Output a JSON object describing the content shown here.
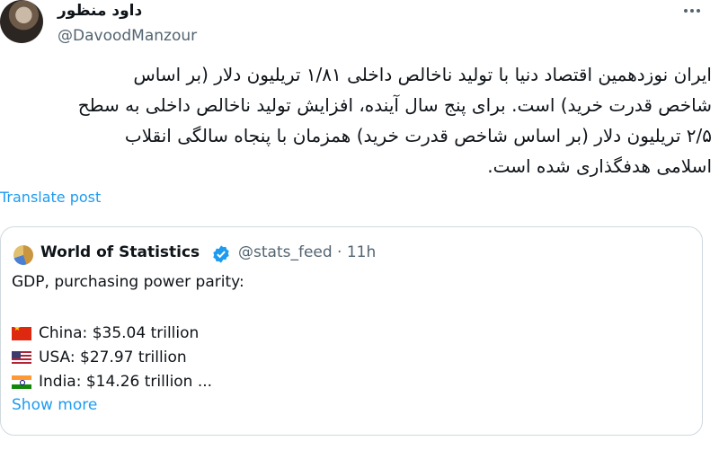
{
  "tweet": {
    "author_name": "داود منظور",
    "author_handle": "@DavoodManzour",
    "text_lines": [
      "ایران نوزدهمین اقتصاد دنیا با تولید ناخالص داخلی ۱/۸۱ تریلیون دلار (بر اساس",
      "شاخص قدرت خرید) است. برای پنج سال آینده، افزایش تولید ناخالص داخلی به سطح",
      "۲/۵ تریلیون دلار (بر اساس شاخص قدرت خرید) همزمان با پنجاه سالگی انقلاب",
      "اسلامی هدفگذاری شده است."
    ],
    "translate_label": "Translate post",
    "more_icon": "more-horizontal-icon"
  },
  "quote": {
    "author_name": "World of Statistics",
    "author_handle": "@stats_feed · 11h",
    "verified_icon": "verified-badge-icon",
    "verified_color": "#1d9bf0",
    "headline": "GDP, purchasing power parity:",
    "items": [
      {
        "flag": "china-flag-icon",
        "text": "China: $35.04 trillion"
      },
      {
        "flag": "usa-flag-icon",
        "text": "USA: $27.97 trillion"
      },
      {
        "flag": "india-flag-icon",
        "text": "India: $14.26 trillion ..."
      }
    ],
    "show_more_label": "Show more"
  },
  "colors": {
    "link": "#1d9bf0",
    "secondary_text": "#536471",
    "border": "#cfd9de"
  }
}
